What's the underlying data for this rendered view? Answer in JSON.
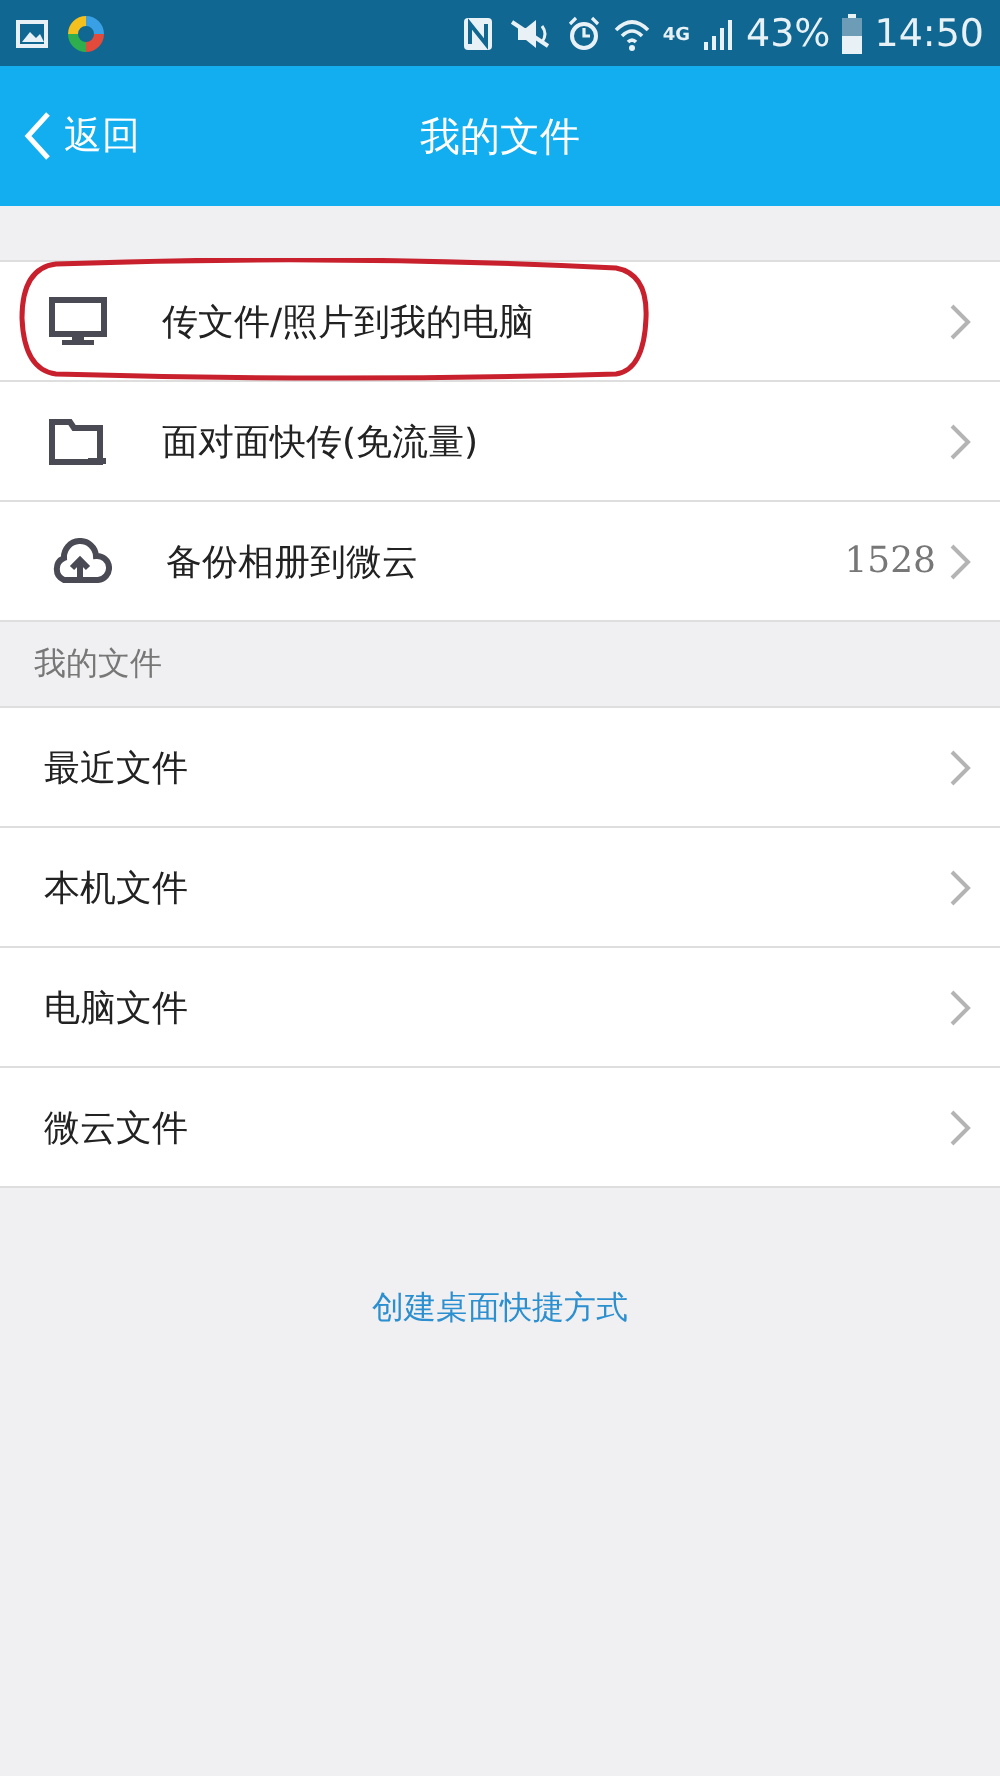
{
  "status_bar": {
    "network": "4G",
    "battery": "43%",
    "time": "14:50"
  },
  "nav": {
    "back": "返回",
    "title": "我的文件"
  },
  "quick_actions": [
    {
      "kind": "monitor",
      "label": "传文件/照片到我的电脑",
      "highlighted": true
    },
    {
      "kind": "folder",
      "label": "面对面快传(免流量)",
      "highlighted": false
    },
    {
      "kind": "cloud",
      "label": "备份相册到微云",
      "count": "1528",
      "highlighted": false
    }
  ],
  "section": {
    "title": "我的文件",
    "items": [
      "最近文件",
      "本机文件",
      "电脑文件",
      "微云文件"
    ]
  },
  "link": "创建桌面快捷方式"
}
